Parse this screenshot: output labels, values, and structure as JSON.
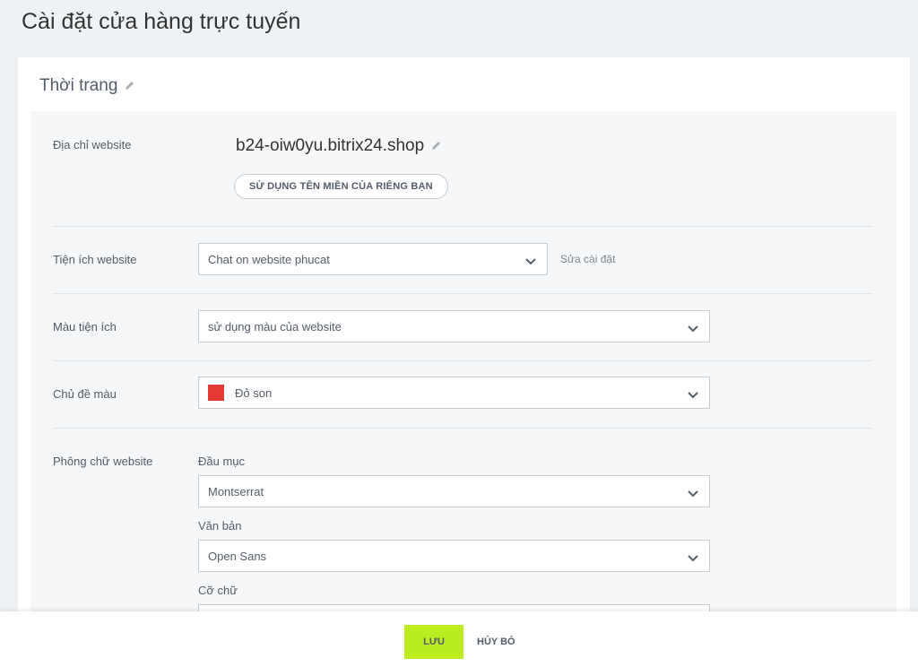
{
  "page": {
    "title": "Cài đặt cửa hàng trực tuyến"
  },
  "store": {
    "name": "Thời trang",
    "name_edit_icon": "pencil-icon"
  },
  "website_address": {
    "label": "Địa chỉ website",
    "domain": "b24-oiw0yu.bitrix24.shop",
    "domain_edit_icon": "pencil-icon",
    "custom_domain_button": "SỬ DỤNG TÊN MIỀN CỦA RIÊNG BẠN"
  },
  "widget": {
    "label": "Tiện ích website",
    "selected": "Chat on website phucat",
    "edit_link": "Sửa cài đặt"
  },
  "widget_color": {
    "label": "Màu tiện ích",
    "selected": "sử dụng màu của website"
  },
  "color_theme": {
    "label": "Chủ đề màu",
    "selected": "Đỏ son",
    "swatch_color": "#e53935"
  },
  "fonts": {
    "label": "Phông chữ website",
    "heading_label": "Đầu mục",
    "heading_selected": "Montserrat",
    "body_label": "Văn bản",
    "body_selected": "Open Sans",
    "size_label": "Cỡ chữ"
  },
  "footer": {
    "save": "LƯU",
    "cancel": "HỦY BỎ"
  },
  "colors": {
    "accent": "#bbed21",
    "background": "#eef2f4"
  }
}
